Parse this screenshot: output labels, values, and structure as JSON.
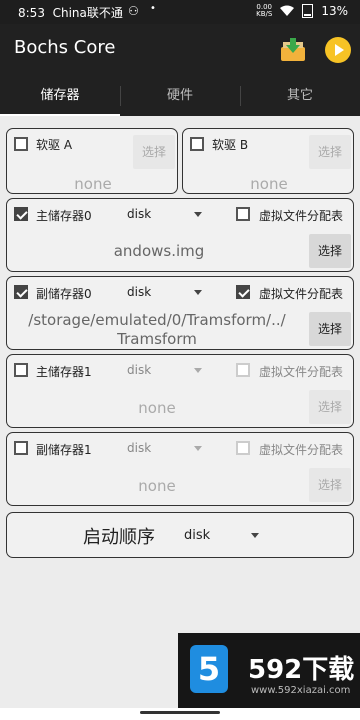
{
  "status": {
    "time": "8:53",
    "carrier": "China联不通",
    "ghost": "⚇",
    "dot": "•",
    "speed_top": "0.00",
    "speed_bot": "KB/S",
    "battery": "13%"
  },
  "app": {
    "title": "Bochs Core"
  },
  "tabs": [
    "储存器",
    "硬件",
    "其它"
  ],
  "floppy_a": {
    "label": "软驱 A",
    "button": "选择",
    "value": "none"
  },
  "floppy_b": {
    "label": "软驱 B",
    "button": "选择",
    "value": "none"
  },
  "ata0_master": {
    "label": "主储存器0",
    "type": "disk",
    "vvfat_label": "虚拟文件分配表",
    "path": "andows.img",
    "button": "选择"
  },
  "ata0_slave": {
    "label": "副储存器0",
    "type": "disk",
    "vvfat_label": "虚拟文件分配表",
    "path_line1": "/storage/emulated/0/Tramsform/../",
    "path_line2": "Tramsform",
    "button": "选择"
  },
  "ata1_master": {
    "label": "主储存器1",
    "type": "disk",
    "vvfat_label": "虚拟文件分配表",
    "value": "none",
    "button": "选择"
  },
  "ata1_slave": {
    "label": "副储存器1",
    "type": "disk",
    "vvfat_label": "虚拟文件分配表",
    "value": "none",
    "button": "选择"
  },
  "boot": {
    "label": "启动顺序",
    "value": "disk"
  },
  "watermark": {
    "title": "592下载",
    "url": "www.592xiazai.com",
    "logo": "5"
  },
  "colors": {
    "toolbar": "#212121",
    "accent_play": "#f7c325",
    "logo": "#1f8de0"
  }
}
